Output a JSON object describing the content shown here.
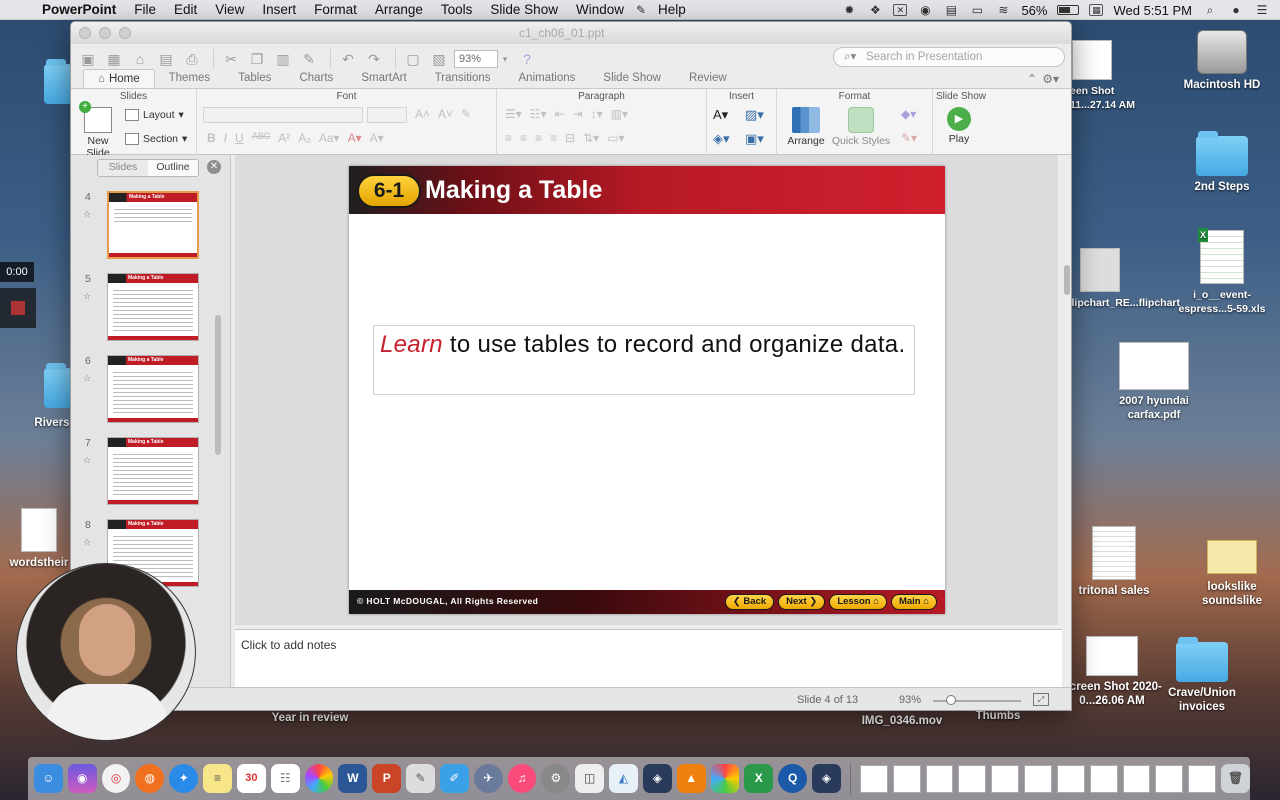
{
  "menubar": {
    "app_name": "PowerPoint",
    "items": [
      "File",
      "Edit",
      "View",
      "Insert",
      "Format",
      "Arrange",
      "Tools",
      "Slide Show",
      "Window",
      "Help"
    ],
    "battery": "56%",
    "clock": "Wed 5:51 PM"
  },
  "window": {
    "doc_title": "c1_ch06_01.ppt",
    "zoom": "93%",
    "search_placeholder": "Search in Presentation"
  },
  "ribbon": {
    "tabs": [
      "Home",
      "Themes",
      "Tables",
      "Charts",
      "SmartArt",
      "Transitions",
      "Animations",
      "Slide Show",
      "Review"
    ],
    "active_tab": "Home",
    "groups": {
      "slides": "Slides",
      "font": "Font",
      "paragraph": "Paragraph",
      "insert": "Insert",
      "format": "Format",
      "slideshow": "Slide Show"
    },
    "buttons": {
      "new_slide": "New Slide",
      "layout": "Layout",
      "section": "Section",
      "arrange": "Arrange",
      "quick_styles": "Quick Styles",
      "play": "Play"
    }
  },
  "panel": {
    "tabs": [
      "Slides",
      "Outline"
    ],
    "thumbnails": [
      {
        "num": "4",
        "title": "Making a Table",
        "selected": true
      },
      {
        "num": "5",
        "title": "Making a Table",
        "selected": false
      },
      {
        "num": "6",
        "title": "Making a Table",
        "selected": false
      },
      {
        "num": "7",
        "title": "Making a Table",
        "selected": false
      },
      {
        "num": "8",
        "title": "Making a Table",
        "selected": false
      }
    ]
  },
  "slide": {
    "badge": "6-1",
    "title": "Making a Table",
    "body_highlight": "Learn",
    "body_rest": " to use tables to record and organize data.",
    "copyright": "© HOLT McDOUGAL, All Rights Reserved",
    "nav": [
      "Back",
      "Next",
      "Lesson",
      "Main"
    ]
  },
  "notes_placeholder": "Click to add notes",
  "status": {
    "slide_position": "Slide 4 of 13",
    "zoom": "93%",
    "zoom_level_fraction": 0.2
  },
  "desktop": {
    "icons": [
      {
        "label": "Macintosh HD"
      },
      {
        "label": "2nd Steps"
      },
      {
        "label": "i_o__event-espress...5-59.xls"
      },
      {
        "label": "flipchart_RE...flipchart"
      },
      {
        "label": "2007 hyundai carfax.pdf"
      },
      {
        "label": "tritonal sales"
      },
      {
        "label": "lookslike soundslike"
      },
      {
        "label": "Screen Shot 2020-0...26.06 AM"
      },
      {
        "label": "Crave/Union invoices"
      },
      {
        "label": "Thumbs"
      },
      {
        "label": "IMG_0346.mov"
      },
      {
        "label": "Year in review"
      },
      {
        "label": "Rivers"
      },
      {
        "label": "wordstheir"
      }
    ],
    "overlay_time": "0:00",
    "screenshot_partial": "een Shot\n11...27.14 AM"
  },
  "colors": {
    "accent_red": "#c8202c",
    "badge_gold": "#f0a800",
    "selection_orange": "#e59b4b"
  }
}
